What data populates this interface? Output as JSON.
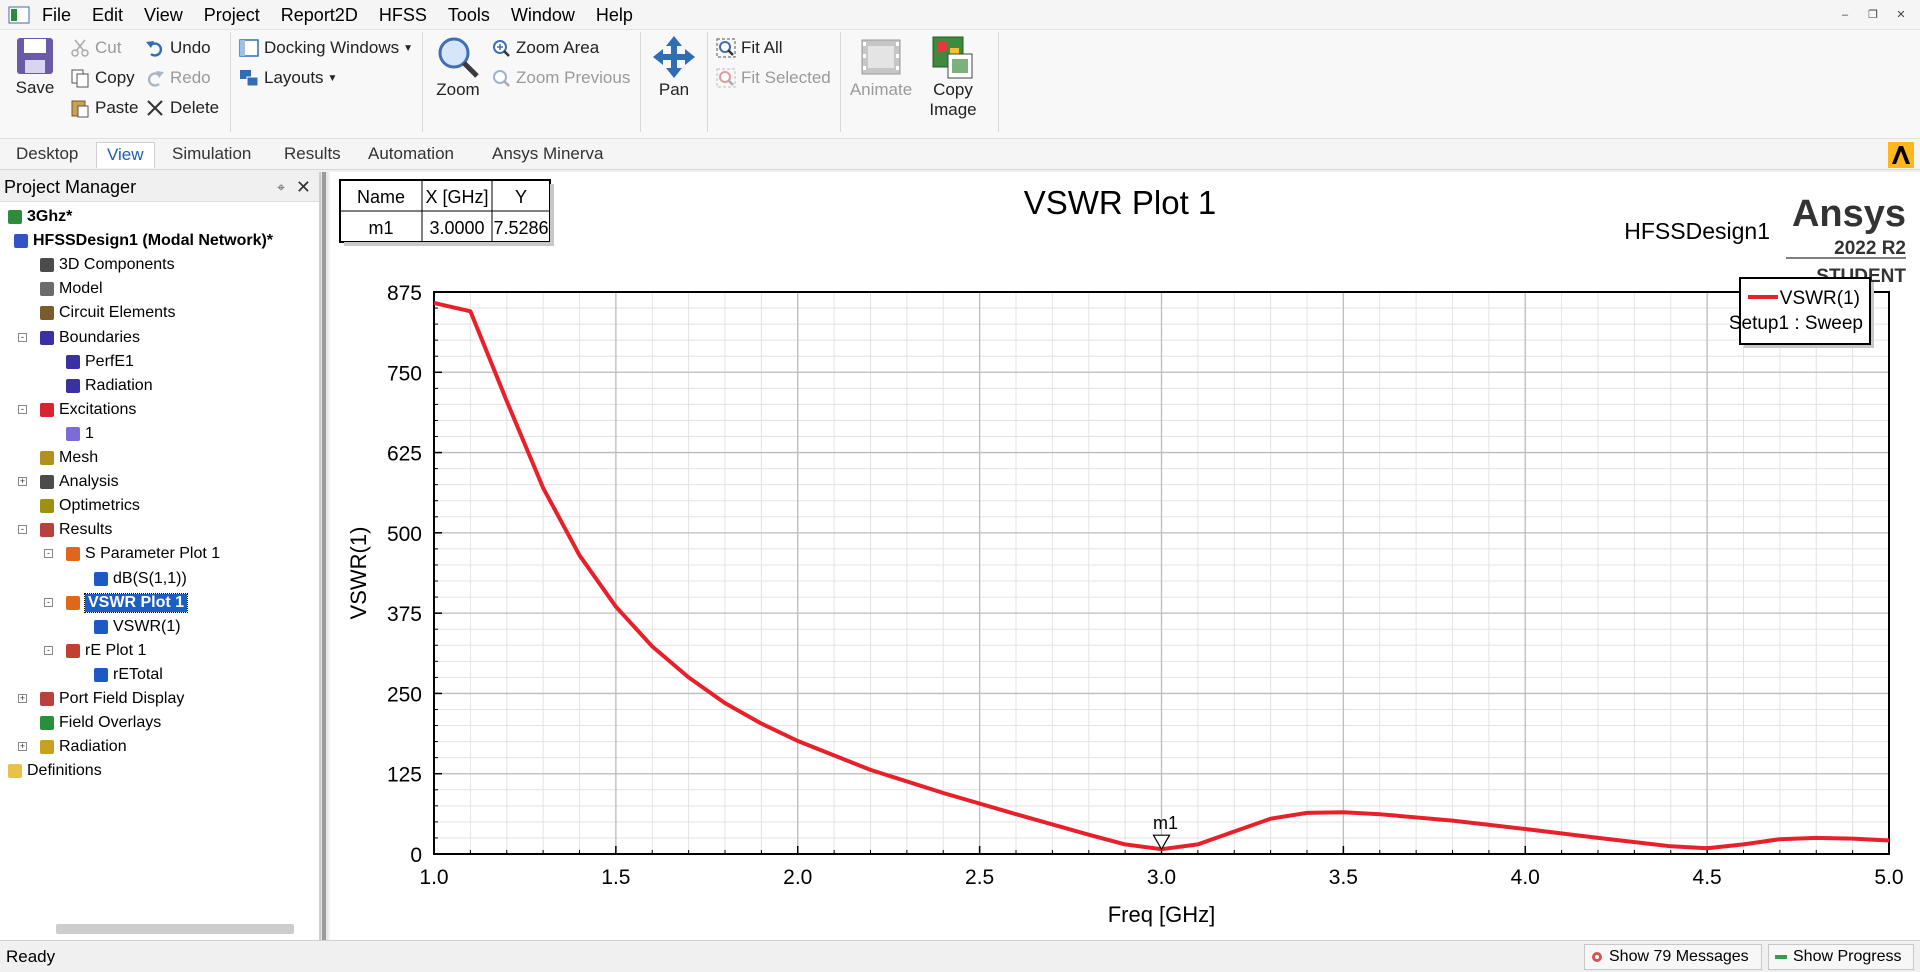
{
  "menu": [
    "File",
    "Edit",
    "View",
    "Project",
    "Report2D",
    "HFSS",
    "Tools",
    "Window",
    "Help"
  ],
  "ribbon": {
    "save": "Save",
    "cut": "Cut",
    "copy": "Copy",
    "paste": "Paste",
    "undo": "Undo",
    "redo": "Redo",
    "delete": "Delete",
    "docking": "Docking Windows",
    "layouts": "Layouts",
    "zoom": "Zoom",
    "zoom_area": "Zoom Area",
    "zoom_previous": "Zoom Previous",
    "pan": "Pan",
    "fit_all": "Fit All",
    "fit_selected": "Fit Selected",
    "animate": "Animate",
    "copy_image_1": "Copy",
    "copy_image_2": "Image"
  },
  "tabs": [
    "Desktop",
    "View",
    "Simulation",
    "Results",
    "Automation",
    "Ansys Minerva"
  ],
  "project_manager": {
    "title": "Project Manager",
    "tree": [
      {
        "label": "3Ghz*",
        "bold": true
      },
      {
        "label": "HFSSDesign1 (Modal Network)*",
        "bold": true
      },
      {
        "label": "3D Components"
      },
      {
        "label": "Model"
      },
      {
        "label": "Circuit Elements"
      },
      {
        "label": "Boundaries"
      },
      {
        "label": "PerfE1"
      },
      {
        "label": "Radiation"
      },
      {
        "label": "Excitations"
      },
      {
        "label": "1"
      },
      {
        "label": "Mesh"
      },
      {
        "label": "Analysis"
      },
      {
        "label": "Optimetrics"
      },
      {
        "label": "Results"
      },
      {
        "label": "S Parameter Plot 1"
      },
      {
        "label": "dB(S(1,1))"
      },
      {
        "label": "VSWR Plot 1",
        "selected": true
      },
      {
        "label": "VSWR(1)"
      },
      {
        "label": "rE Plot 1"
      },
      {
        "label": "rETotal"
      },
      {
        "label": "Port Field Display"
      },
      {
        "label": "Field Overlays"
      },
      {
        "label": "Radiation"
      },
      {
        "label": "Definitions"
      }
    ]
  },
  "plot": {
    "design_name": "HFSSDesign1",
    "brand": "Ansys",
    "version": "2022 R2",
    "edition": "STUDENT",
    "marker_table": {
      "headers": [
        "Name",
        "X [GHz]",
        "Y"
      ],
      "row": [
        "m1",
        "3.0000",
        "7.5286"
      ]
    },
    "marker_label": "m1",
    "legend": {
      "line1": "VSWR(1)",
      "line2": "Setup1 : Sweep"
    }
  },
  "chart_data": {
    "type": "line",
    "title": "VSWR Plot 1",
    "xlabel": "Freq [GHz]",
    "ylabel": "VSWR(1)",
    "xlim": [
      1.0,
      5.0
    ],
    "ylim": [
      0,
      875
    ],
    "xticks": [
      "1.0",
      "1.5",
      "2.0",
      "2.5",
      "3.0",
      "3.5",
      "4.0",
      "4.5",
      "5.0"
    ],
    "yticks": [
      "0",
      "125",
      "250",
      "375",
      "500",
      "625",
      "750",
      "875"
    ],
    "grid": true,
    "legend_position": "top-right",
    "series_color": "#e8202a",
    "series": [
      {
        "name": "VSWR(1)",
        "x": [
          1.0,
          1.1,
          1.2,
          1.3,
          1.4,
          1.5,
          1.6,
          1.7,
          1.8,
          1.9,
          2.0,
          2.2,
          2.4,
          2.6,
          2.8,
          2.9,
          3.0,
          3.1,
          3.2,
          3.3,
          3.4,
          3.5,
          3.6,
          3.8,
          4.0,
          4.2,
          4.4,
          4.5,
          4.6,
          4.7,
          4.8,
          4.9,
          5.0
        ],
        "y": [
          858,
          845,
          705,
          570,
          465,
          385,
          323,
          275,
          235,
          203,
          176,
          131,
          95,
          62,
          30,
          15,
          7.53,
          15,
          35,
          55,
          64,
          65,
          62,
          52,
          39,
          25,
          12,
          9,
          15,
          23,
          25,
          24,
          21
        ]
      }
    ],
    "marker": {
      "name": "m1",
      "x": 3.0,
      "y": 7.5286
    }
  },
  "status": {
    "ready": "Ready",
    "messages": "Show 79 Messages",
    "progress": "Show Progress"
  }
}
